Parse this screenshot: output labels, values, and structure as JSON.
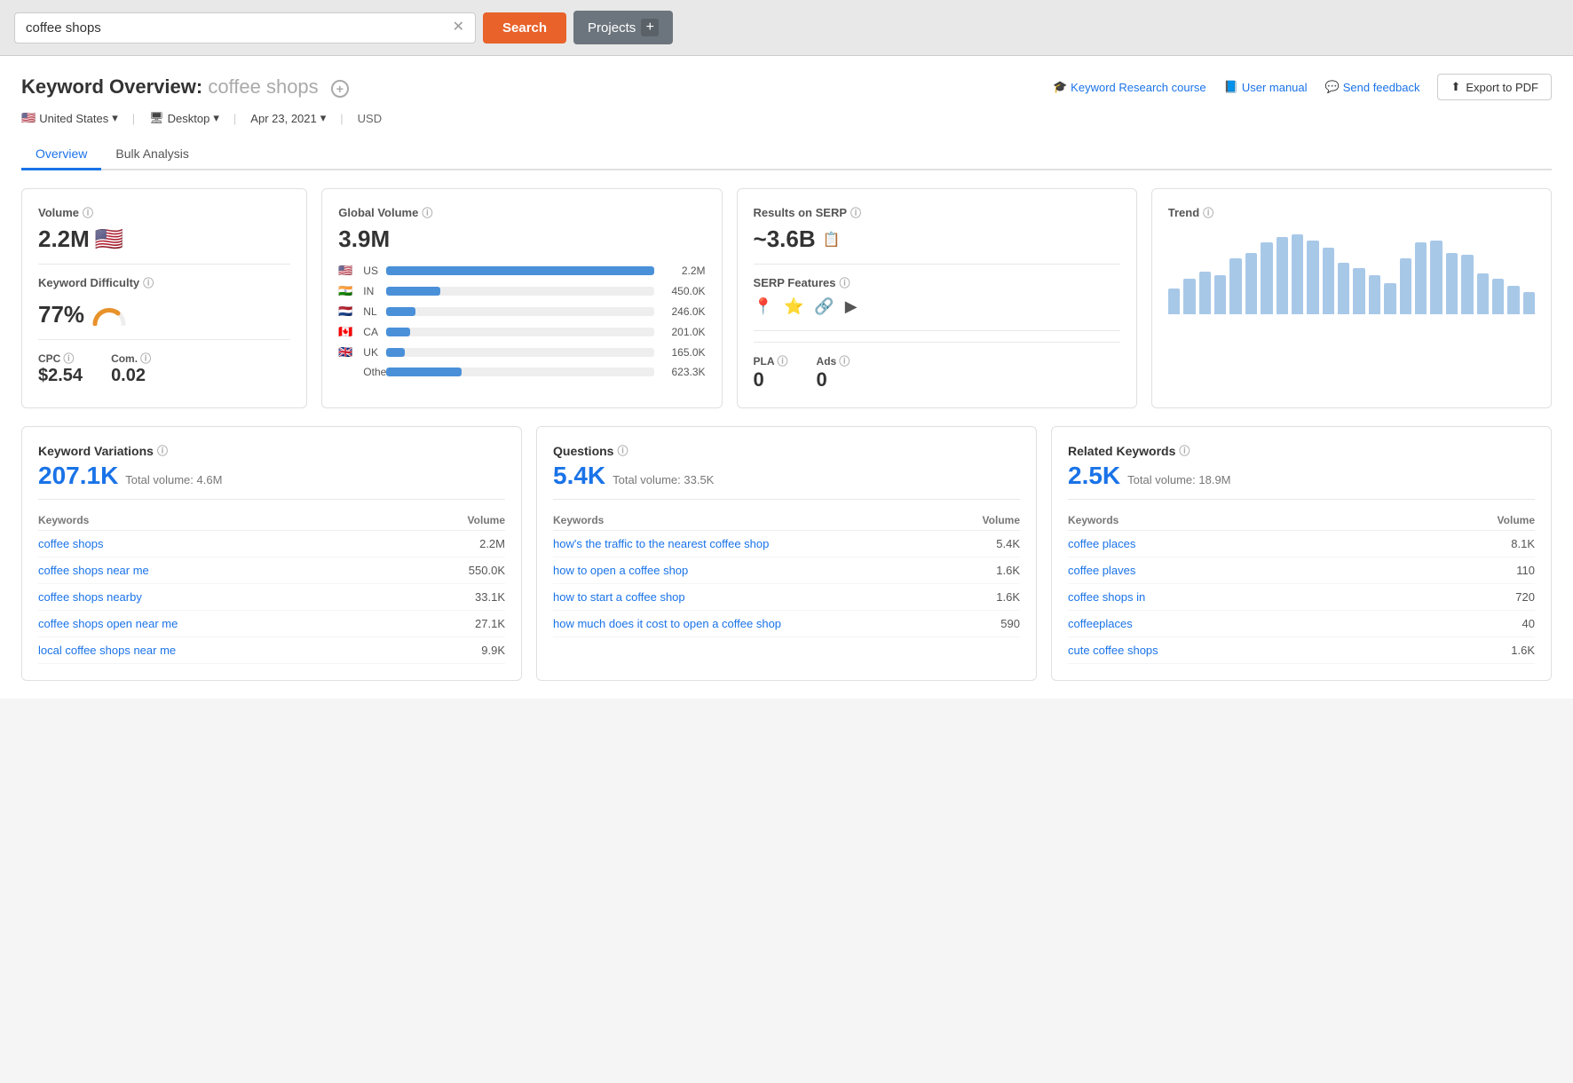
{
  "searchBar": {
    "inputValue": "coffee shops",
    "searchLabel": "Search",
    "projectsLabel": "Projects",
    "plusSymbol": "+"
  },
  "pageHeader": {
    "titlePrefix": "Keyword Overview:",
    "keyword": "coffee shops",
    "addIconSymbol": "+",
    "links": {
      "course": "Keyword Research course",
      "manual": "User manual",
      "feedback": "Send feedback",
      "exportBtn": "Export to PDF"
    }
  },
  "filters": {
    "country": "United States",
    "device": "Desktop",
    "date": "Apr 23, 2021",
    "currency": "USD"
  },
  "tabs": [
    {
      "label": "Overview",
      "active": true
    },
    {
      "label": "Bulk Analysis",
      "active": false
    }
  ],
  "volumeCard": {
    "label": "Volume",
    "value": "2.2M",
    "flagEmoji": "🇺🇸",
    "kdLabel": "Keyword Difficulty",
    "kdValue": "77%",
    "cpcLabel": "CPC",
    "cpcValue": "$2.54",
    "comLabel": "Com.",
    "comValue": "0.02"
  },
  "globalVolumeCard": {
    "label": "Global Volume",
    "value": "3.9M",
    "countries": [
      {
        "flag": "🇺🇸",
        "code": "US",
        "volume": "2.2M",
        "barPct": 100
      },
      {
        "flag": "🇮🇳",
        "code": "IN",
        "volume": "450.0K",
        "barPct": 20
      },
      {
        "flag": "🇳🇱",
        "code": "NL",
        "volume": "246.0K",
        "barPct": 11
      },
      {
        "flag": "🇨🇦",
        "code": "CA",
        "volume": "201.0K",
        "barPct": 9
      },
      {
        "flag": "🇬🇧",
        "code": "UK",
        "volume": "165.0K",
        "barPct": 7
      },
      {
        "flag": "",
        "code": "Other",
        "volume": "623.3K",
        "barPct": 28
      }
    ]
  },
  "serpCard": {
    "label": "Results on SERP",
    "value": "~3.6B",
    "serpFeaturesLabel": "SERP Features",
    "icons": [
      "📍",
      "⭐",
      "🔗",
      "▶"
    ],
    "plaLabel": "PLA",
    "plaValue": "0",
    "adsLabel": "Ads",
    "adsValue": "0"
  },
  "trendCard": {
    "label": "Trend",
    "bars": [
      25,
      35,
      42,
      38,
      55,
      60,
      70,
      75,
      78,
      72,
      65,
      50,
      45,
      38,
      30,
      55,
      70,
      72,
      60,
      58,
      40,
      35,
      28,
      22
    ]
  },
  "keywordVariations": {
    "title": "Keyword Variations",
    "count": "207.1K",
    "totalVolumeLabel": "Total volume:",
    "totalVolume": "4.6M",
    "colKeywords": "Keywords",
    "colVolume": "Volume",
    "rows": [
      {
        "keyword": "coffee shops",
        "volume": "2.2M"
      },
      {
        "keyword": "coffee shops near me",
        "volume": "550.0K"
      },
      {
        "keyword": "coffee shops nearby",
        "volume": "33.1K"
      },
      {
        "keyword": "coffee shops open near me",
        "volume": "27.1K"
      },
      {
        "keyword": "local coffee shops near me",
        "volume": "9.9K"
      }
    ]
  },
  "questions": {
    "title": "Questions",
    "count": "5.4K",
    "totalVolumeLabel": "Total volume:",
    "totalVolume": "33.5K",
    "colKeywords": "Keywords",
    "colVolume": "Volume",
    "rows": [
      {
        "keyword": "how's the traffic to the nearest coffee shop",
        "volume": "5.4K"
      },
      {
        "keyword": "how to open a coffee shop",
        "volume": "1.6K"
      },
      {
        "keyword": "how to start a coffee shop",
        "volume": "1.6K"
      },
      {
        "keyword": "how much does it cost to open a coffee shop",
        "volume": "590"
      }
    ]
  },
  "relatedKeywords": {
    "title": "Related Keywords",
    "count": "2.5K",
    "totalVolumeLabel": "Total volume:",
    "totalVolume": "18.9M",
    "colKeywords": "Keywords",
    "colVolume": "Volume",
    "rows": [
      {
        "keyword": "coffee places",
        "volume": "8.1K"
      },
      {
        "keyword": "coffee plaves",
        "volume": "110"
      },
      {
        "keyword": "coffee shops in",
        "volume": "720"
      },
      {
        "keyword": "coffeeplaces",
        "volume": "40"
      },
      {
        "keyword": "cute coffee shops",
        "volume": "1.6K"
      }
    ]
  },
  "icons": {
    "infoSymbol": "i",
    "locationSymbol": "📍",
    "starSymbol": "⭐",
    "linkSymbol": "🔗",
    "playSymbol": "▶",
    "pageSymbol": "📋",
    "flagSymbol": "🏳️",
    "courseSymbol": "🎓",
    "manualSymbol": "📘",
    "feedbackSymbol": "💬",
    "exportSymbol": "⬆"
  }
}
